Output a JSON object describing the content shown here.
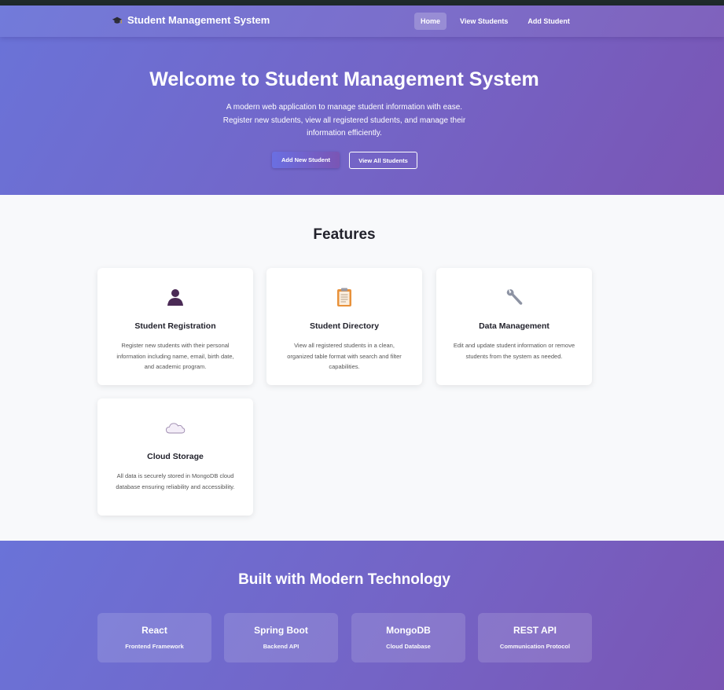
{
  "navbar": {
    "brand_icon": "graduation-cap-icon",
    "brand": "Student Management System",
    "links": [
      "Home",
      "View Students",
      "Add Student"
    ],
    "active": "Home"
  },
  "hero": {
    "title": "Welcome to Student Management System",
    "description": "A modern web application to manage student information with ease. Register new students, view all registered students, and manage their information efficiently.",
    "primary_button": "Add New Student",
    "secondary_button": "View All Students"
  },
  "features": {
    "title": "Features",
    "cards": [
      {
        "icon": "person-silhouette-icon",
        "title": "Student Registration",
        "text": "Register new students with their personal information including name, email, birth date, and academic program."
      },
      {
        "icon": "clipboard-icon",
        "title": "Student Directory",
        "text": "View all registered students in a clean, organized table format with search and filter capabilities."
      },
      {
        "icon": "wrench-icon",
        "title": "Data Management",
        "text": "Edit and update student information or remove students from the system as needed."
      },
      {
        "icon": "cloud-icon",
        "title": "Cloud Storage",
        "text": "All data is securely stored in MongoDB cloud database ensuring reliability and accessibility."
      }
    ]
  },
  "technology": {
    "title": "Built with Modern Technology",
    "items": [
      {
        "name": "React",
        "desc": "Frontend Framework"
      },
      {
        "name": "Spring Boot",
        "desc": "Backend API"
      },
      {
        "name": "MongoDB",
        "desc": "Cloud Database"
      },
      {
        "name": "REST API",
        "desc": "Communication Protocol"
      }
    ]
  },
  "colors": {
    "gradient_start": "#6a73d8",
    "gradient_end": "#7a55b4",
    "page_background": "#f8f9fb"
  }
}
